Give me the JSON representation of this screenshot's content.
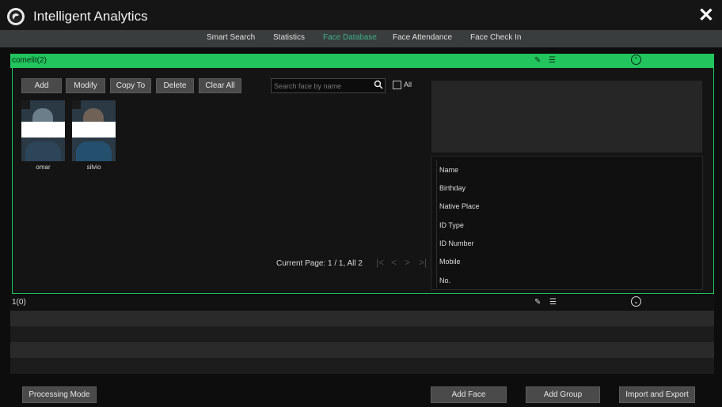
{
  "window": {
    "title": "Intelligent Analytics",
    "close_symbol": "✕",
    "logo_icon": "app-logo-icon"
  },
  "tabs": [
    {
      "label": "Smart Search",
      "active": false
    },
    {
      "label": "Statistics",
      "active": false
    },
    {
      "label": "Face Database",
      "active": true
    },
    {
      "label": "Face Attendance",
      "active": false
    },
    {
      "label": "Face Check In",
      "active": false
    }
  ],
  "groups": [
    {
      "name": "comelit(2)",
      "expanded": true,
      "edit_icon": "pencil-icon",
      "delete_icon": "trash-icon",
      "toggle_icon": "chevron-up-icon"
    },
    {
      "name": "1(0)",
      "expanded": false,
      "edit_icon": "pencil-icon",
      "delete_icon": "trash-icon",
      "toggle_icon": "chevron-down-icon"
    }
  ],
  "toolbar": {
    "add_label": "Add",
    "modify_label": "Modify",
    "copy_to_label": "Copy To",
    "delete_label": "Delete",
    "clear_all_label": "Clear All"
  },
  "faces": [
    {
      "name": "omar"
    },
    {
      "name": "silvio"
    }
  ],
  "search": {
    "placeholder": "Search face by name",
    "value": "",
    "all_label": "All",
    "all_checked": false
  },
  "pagination": {
    "text": "Current Page: 1 / 1, All 2",
    "first_symbol": "|<",
    "prev_symbol": "<",
    "next_symbol": ">",
    "last_symbol": ">|"
  },
  "info_fields": [
    "Name",
    "Birthday",
    "Native Place",
    "ID Type",
    "ID Number",
    "Mobile",
    "No."
  ],
  "footer": {
    "processing_mode_label": "Processing Mode",
    "add_face_label": "Add Face",
    "add_group_label": "Add Group",
    "import_export_label": "Import and Export"
  },
  "colors": {
    "accent_green": "#21c45d",
    "active_tab": "#3fb08a",
    "background": "#0d0d0d",
    "button": "#4a4a4a"
  }
}
